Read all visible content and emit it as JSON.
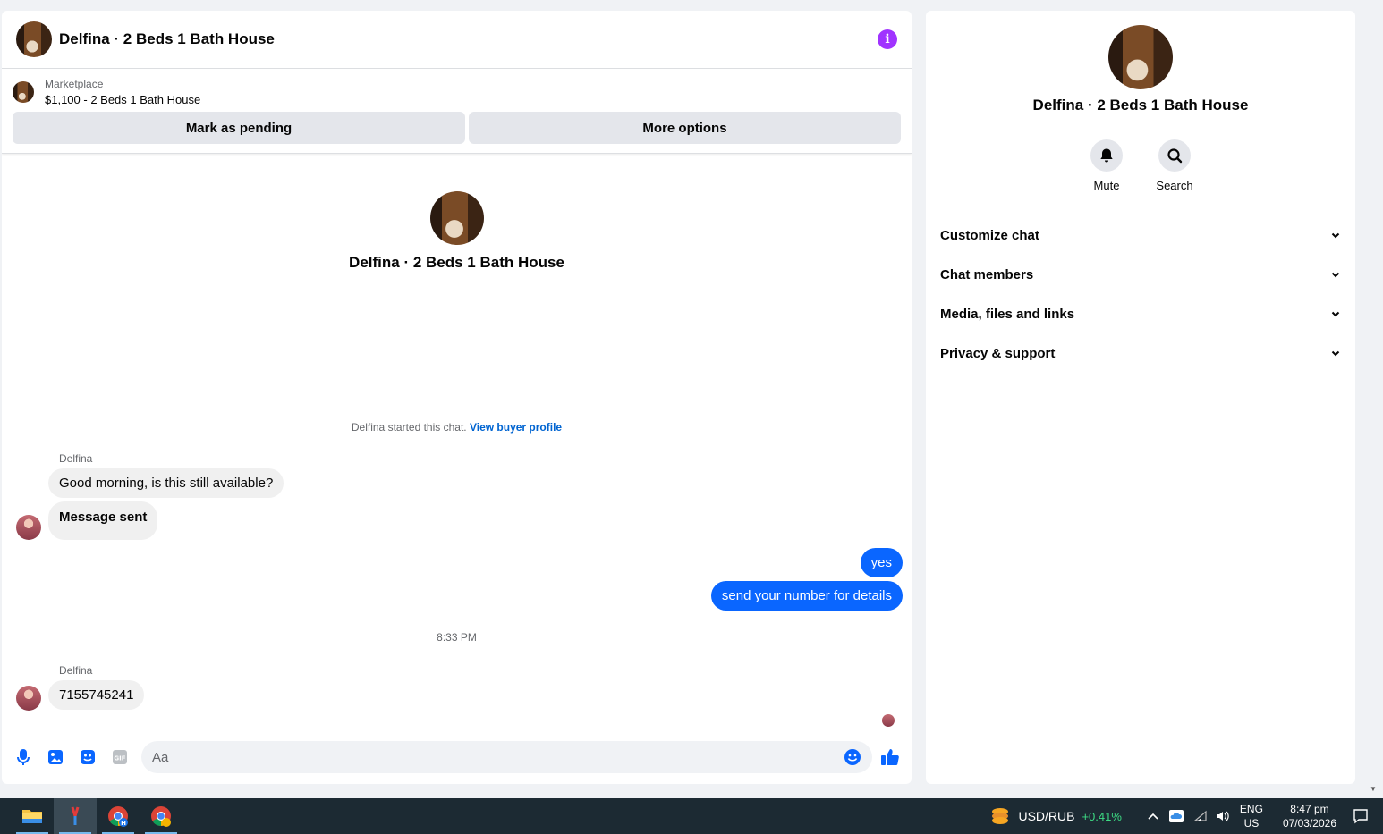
{
  "chat": {
    "title": "Delfina · 2 Beds 1 Bath House",
    "listing": {
      "category": "Marketplace",
      "name": "$1,100 - 2 Beds 1 Bath House",
      "mark_pending": "Mark as pending",
      "more_options": "More options"
    },
    "intro_name": "Delfina · 2 Beds 1 Bath House",
    "started_text": "Delfina started this chat.",
    "view_profile": "View buyer profile",
    "messages": [
      {
        "sender": "Delfina",
        "text": "Good morning, is this still available?"
      },
      {
        "text": "Message sent"
      },
      {
        "text": "yes"
      },
      {
        "text": "send your number for details"
      },
      {
        "timestamp": "8:33 PM"
      },
      {
        "sender": "Delfina",
        "text": "7155745241"
      }
    ],
    "composer_placeholder": "Aa"
  },
  "side": {
    "name": "Delfina · 2 Beds 1 Bath House",
    "actions": [
      {
        "label": "Mute"
      },
      {
        "label": "Search"
      }
    ],
    "sections": [
      "Customize chat",
      "Chat members",
      "Media, files and links",
      "Privacy & support"
    ]
  },
  "taskbar": {
    "ticker": "USD/RUB",
    "change": "+0.41%",
    "lang_top": "ENG",
    "lang_bottom": "US",
    "time": "8:47 pm",
    "date": "07/03/2026"
  },
  "colors": {
    "accent": "#0a66ff",
    "info": "#a033ff",
    "positive": "#3ddc84"
  }
}
